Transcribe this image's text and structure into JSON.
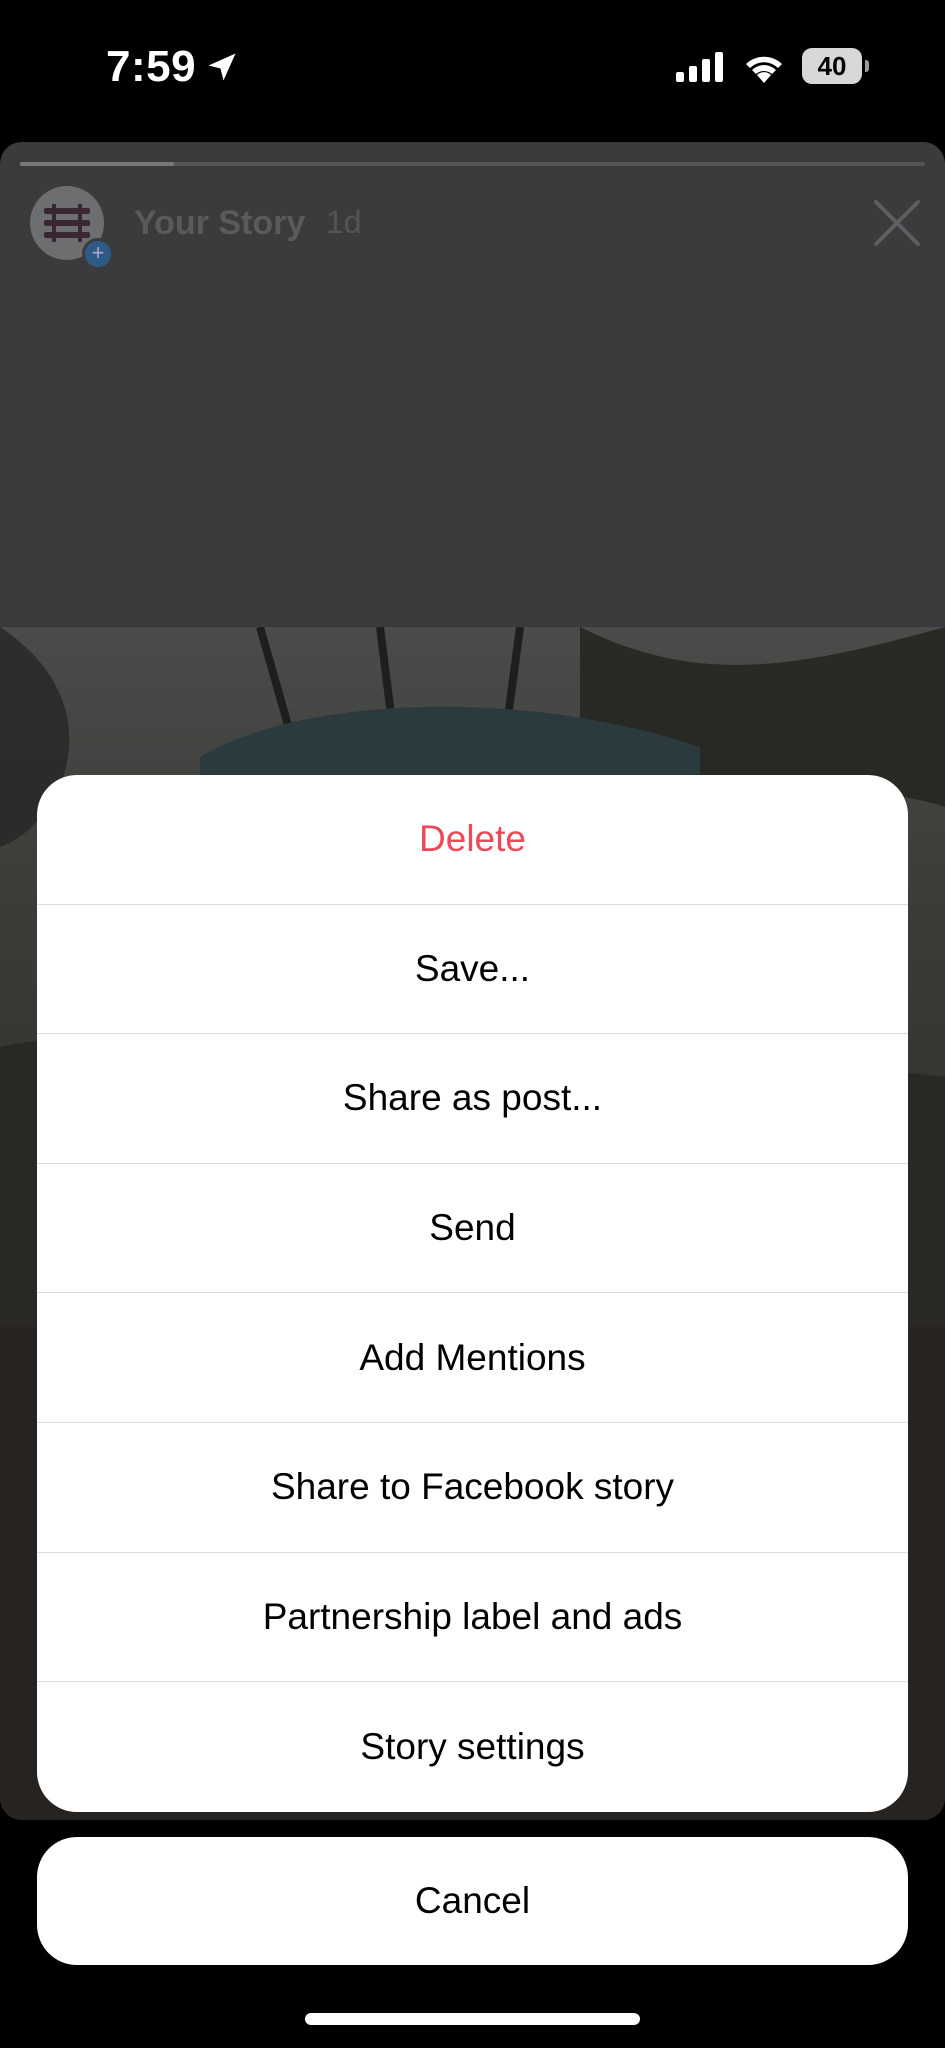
{
  "status_bar": {
    "time": "7:59",
    "battery": "40",
    "icons": [
      "location-arrow-icon",
      "cellular-signal-icon",
      "wifi-icon",
      "battery-icon"
    ]
  },
  "story": {
    "username": "Your Story",
    "age": "1d",
    "progress": 0.17
  },
  "action_sheet": {
    "items": [
      {
        "label": "Delete",
        "color": "#ed4956"
      },
      {
        "label": "Save..."
      },
      {
        "label": "Share as post..."
      },
      {
        "label": "Send"
      },
      {
        "label": "Add Mentions"
      },
      {
        "label": "Share to Facebook story"
      },
      {
        "label": "Partnership label and ads"
      },
      {
        "label": "Story settings"
      }
    ],
    "cancel": "Cancel"
  }
}
